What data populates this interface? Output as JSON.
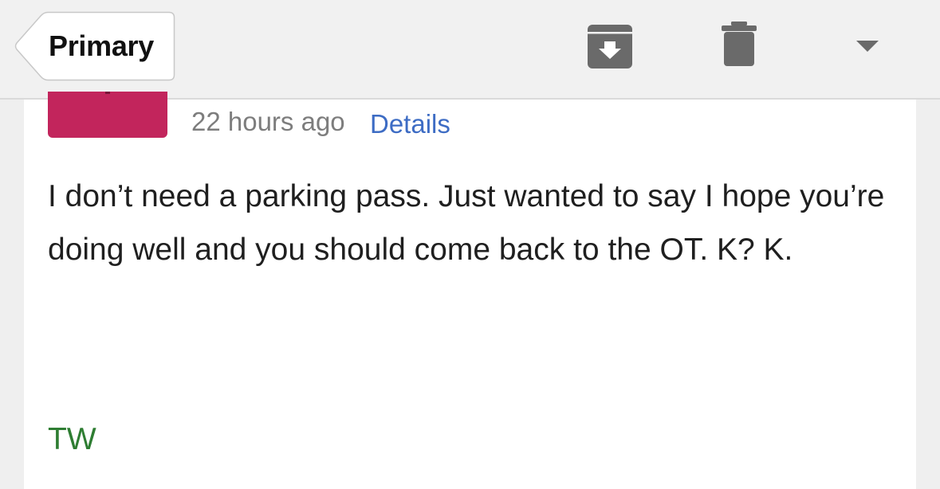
{
  "toolbar": {
    "back_label": "Primary",
    "archive_icon": "archive-icon",
    "trash_icon": "trash-icon",
    "more_icon": "chevron-down-icon",
    "icon_color": "#6a6a6a"
  },
  "message": {
    "avatar_color": "#c2255c",
    "timestamp": "22 hours ago",
    "details_link": "Details",
    "link_color": "#3d6cc4",
    "body": "I don’t need a parking pass. Just wanted to say I hope you’re doing well and you should come back to the OT. K? K.",
    "signature": "TW",
    "signature_color": "#2e7d32"
  }
}
